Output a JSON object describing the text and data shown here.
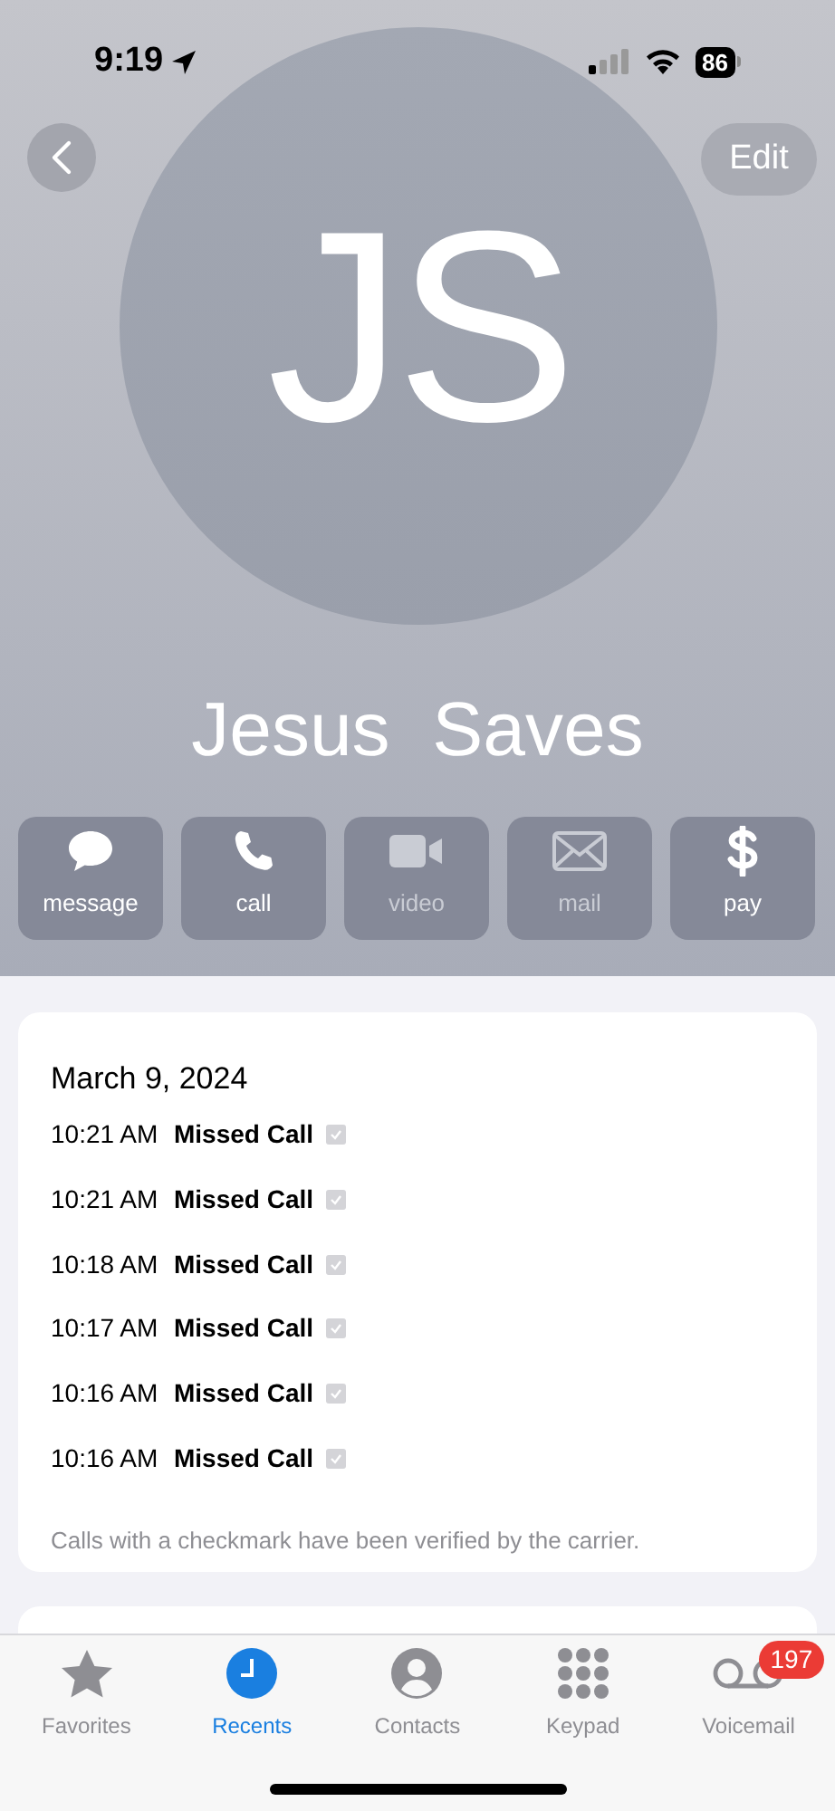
{
  "status_bar": {
    "time": "9:19",
    "battery": "86"
  },
  "header": {
    "edit": "Edit",
    "initials": "JS",
    "name": "Jesus  Saves"
  },
  "actions": [
    {
      "kind": "message",
      "label": "message",
      "disabled": false
    },
    {
      "kind": "call",
      "label": "call",
      "disabled": false
    },
    {
      "kind": "video",
      "label": "video",
      "disabled": true
    },
    {
      "kind": "mail",
      "label": "mail",
      "disabled": true
    },
    {
      "kind": "pay",
      "label": "pay",
      "disabled": false
    }
  ],
  "call_log": {
    "date": "March 9, 2024",
    "calls": [
      {
        "time": "10:21 AM",
        "type": "Missed Call",
        "verified": true
      },
      {
        "time": "10:21 AM",
        "type": "Missed Call",
        "verified": true
      },
      {
        "time": "10:18 AM",
        "type": "Missed Call",
        "verified": true
      },
      {
        "time": "10:17 AM",
        "type": "Missed Call",
        "verified": true
      },
      {
        "time": "10:16 AM",
        "type": "Missed Call",
        "verified": true
      },
      {
        "time": "10:16 AM",
        "type": "Missed Call",
        "verified": true
      }
    ],
    "note": "Calls with a checkmark have been verified by the carrier."
  },
  "tab_bar": [
    {
      "kind": "favorites",
      "label": "Favorites",
      "selected": false
    },
    {
      "kind": "recents",
      "label": "Recents",
      "selected": true
    },
    {
      "kind": "contacts",
      "label": "Contacts",
      "selected": false
    },
    {
      "kind": "keypad",
      "label": "Keypad",
      "selected": false
    },
    {
      "kind": "voicemail",
      "label": "Voicemail",
      "selected": false,
      "badge": "197"
    }
  ]
}
